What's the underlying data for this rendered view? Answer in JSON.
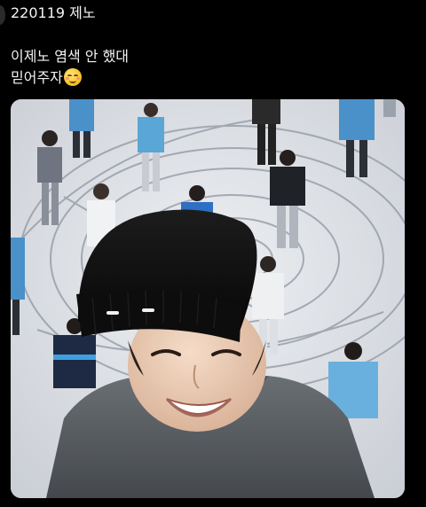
{
  "post": {
    "username": "220119 제노",
    "text_line_1": "이제노 염색 안 했대",
    "text_line_2": "믿어주자",
    "emoji": "smiling-face-icon"
  },
  "media": {
    "kind": "video-frame-photo",
    "colors": {
      "background": "#000000",
      "text": "#e7e9ea",
      "floor": "#e4e7ec",
      "beanie": "#111111",
      "hoodie": "#5a5f63"
    }
  }
}
